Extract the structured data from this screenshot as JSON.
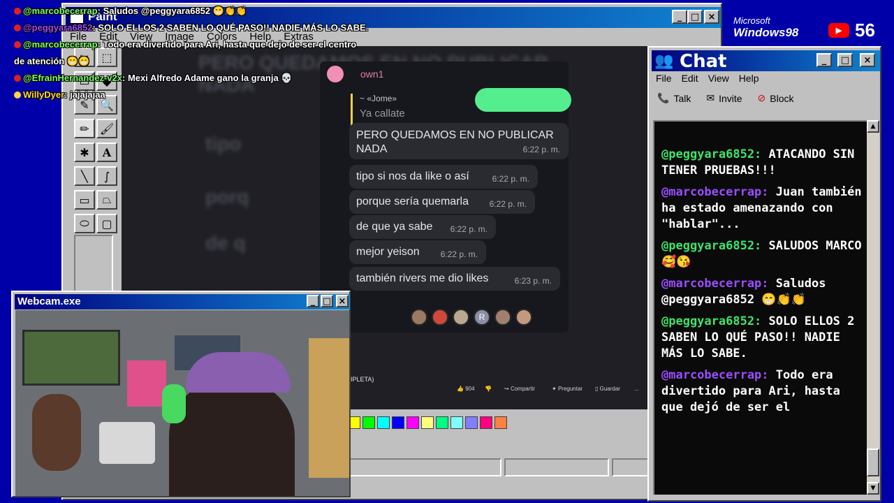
{
  "paint": {
    "title": "Paint",
    "menu": [
      "File",
      "Edit",
      "View",
      "Image",
      "Colors",
      "Help",
      "Extras"
    ],
    "palette": [
      "#ffff00",
      "#00ff00",
      "#00ffff",
      "#0000ff",
      "#ff00ff",
      "#ffff80",
      "#00ff80",
      "#80ffff",
      "#8080ff",
      "#ff0080",
      "#ff8040"
    ]
  },
  "video": {
    "bg_text": [
      "PERO QUEDAMOS EN NO PUBLICAR",
      "NADA",
      "tipo",
      "porq",
      "de q"
    ],
    "notice": "own1",
    "reply_from": "~ «Jome»",
    "reply_text": "Ya callate",
    "messages": [
      {
        "text": "PERO QUEDAMOS EN NO PUBLICAR NADA",
        "time": "6:22 p. m."
      },
      {
        "text": "tipo si nos da like o así",
        "time": "6:22 p. m."
      },
      {
        "text": "porque sería quemarla",
        "time": "6:22 p. m."
      },
      {
        "text": "de que ya sabe",
        "time": "6:22 p. m."
      },
      {
        "text": "mejor yeison",
        "time": "6:22 p. m."
      },
      {
        "text": "también rivers me dio likes",
        "time": "6:23 p. m."
      }
    ],
    "avatar_letter": "R",
    "caption": "IPLETA)",
    "actions": {
      "likes": "904",
      "share": "Compartir",
      "ask": "Preguntar",
      "save": "Guardar",
      "more": "..."
    }
  },
  "chat": {
    "title": "Chat",
    "menu": [
      "File",
      "Edit",
      "View",
      "Help"
    ],
    "toolbar": [
      "Talk",
      "Invite",
      "Block"
    ],
    "messages": [
      {
        "user": "@peggyara6852:",
        "text": "ATACANDO SIN TENER PRUEBAS!!!",
        "color": "green"
      },
      {
        "user": "@marcobecerrap:",
        "text": "Juan también ha estado amenazando con \"hablar\"...",
        "color": "purple"
      },
      {
        "user": "@peggyara6852:",
        "text": "SALUDOS MARCO 🥰😘",
        "color": "green"
      },
      {
        "user": "@marcobecerrap:",
        "text": "Saludos @peggyara6852 😁👏👏",
        "color": "purple"
      },
      {
        "user": "@peggyara6852:",
        "text": "SOLO ELLOS 2 SABEN LO QUÉ PASO!! NADIE MÁS LO SABE.",
        "color": "green"
      },
      {
        "user": "@marcobecerrap:",
        "text": "Todo era divertido para Ari, hasta que dejó de ser el",
        "color": "purple"
      }
    ]
  },
  "webcam": {
    "title": "Webcam.exe"
  },
  "overlay": [
    {
      "user": "@marcobecerrap",
      "text": ": Saludos @peggyara6852 😁👏👏",
      "color": "green"
    },
    {
      "user": "@peggyara6852",
      "text": ": SOLO ELLOS 2 SABEN LO QUÉ PASO!! NADIE MÁS LO SABE.",
      "color": "purple"
    },
    {
      "user": "@marcobecerrap",
      "text": ": Todo era divertido para Ari, hasta que dejo de ser el centro",
      "color": "green"
    },
    {
      "user": "",
      "text": "de atención 😁😁",
      "color": "green"
    },
    {
      "user": "@EfrainHernandez-v2x",
      "text": ": Mexi Alfredo Adame gano la granja 💀",
      "color": "green"
    },
    {
      "user": "WillyDyer",
      "text": ": jajajajaa",
      "color": "yellow"
    }
  ],
  "branding": {
    "ms": "Microsoft",
    "windows": "Windows98",
    "viewer_count": "56"
  }
}
